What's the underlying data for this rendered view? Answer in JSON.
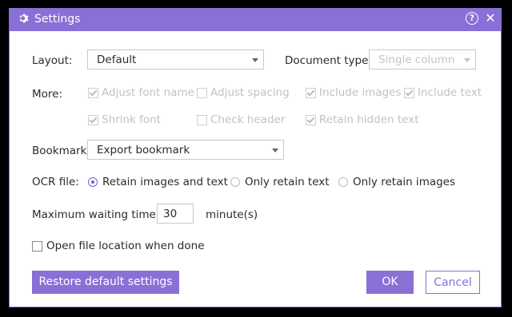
{
  "window": {
    "title": "Settings",
    "accent": "#8a6fd6"
  },
  "layout": {
    "label": "Layout:",
    "value": "Default"
  },
  "document_type": {
    "label": "Document type:",
    "value": "Single column"
  },
  "more": {
    "label": "More:",
    "options": [
      {
        "label": "Adjust font name",
        "checked": true
      },
      {
        "label": "Adjust spacing",
        "checked": false
      },
      {
        "label": "Include images",
        "checked": true
      },
      {
        "label": "Include text",
        "checked": true
      },
      {
        "label": "Shrink font",
        "checked": true
      },
      {
        "label": "Check header",
        "checked": false
      },
      {
        "label": "Retain hidden text",
        "checked": true
      }
    ]
  },
  "bookmark": {
    "label": "Bookmark:",
    "value": "Export bookmark"
  },
  "ocr": {
    "label": "OCR file:",
    "options": [
      {
        "label": "Retain images and text",
        "selected": true
      },
      {
        "label": "Only retain text",
        "selected": false
      },
      {
        "label": "Only retain images",
        "selected": false
      }
    ]
  },
  "wait": {
    "label": "Maximum waiting time",
    "value": "30",
    "unit": "minute(s)"
  },
  "open_location": {
    "label": "Open file location when done",
    "checked": false
  },
  "buttons": {
    "restore": "Restore default settings",
    "ok": "OK",
    "cancel": "Cancel"
  }
}
